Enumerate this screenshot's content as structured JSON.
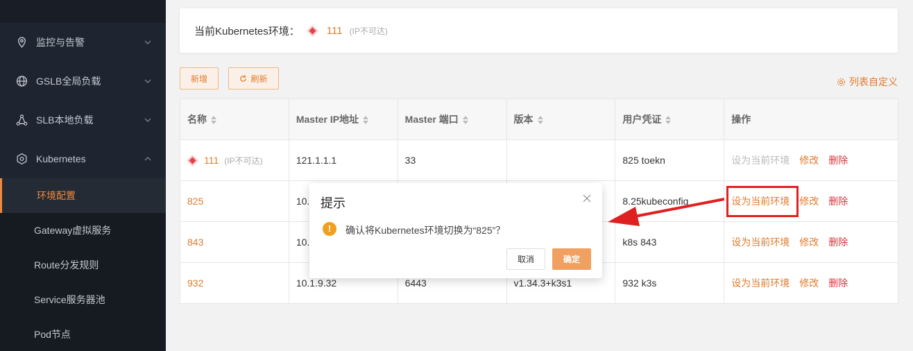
{
  "sidebar": {
    "groups": [
      {
        "label": "监控与告警",
        "icon": "location-pin-icon"
      },
      {
        "label": "GSLB全局负载",
        "icon": "globe-icon"
      },
      {
        "label": "SLB本地负载",
        "icon": "nodes-icon"
      },
      {
        "label": "Kubernetes",
        "icon": "kubernetes-icon"
      }
    ],
    "subitems": [
      {
        "label": "环境配置",
        "active": true
      },
      {
        "label": "Gateway虚拟服务"
      },
      {
        "label": "Route分发规则"
      },
      {
        "label": "Service服务器池"
      },
      {
        "label": "Pod节点"
      }
    ]
  },
  "env": {
    "label": "当前Kubernetes环境：",
    "name": "111",
    "note": "(IP不可达)"
  },
  "toolbar": {
    "add_label": "新增",
    "refresh_label": "刷新",
    "customize_label": "列表自定义"
  },
  "table": {
    "headers": [
      "名称",
      "Master IP地址",
      "Master 端口",
      "版本",
      "用户凭证",
      "操作"
    ],
    "rows": [
      {
        "name": "111",
        "note": "(IP不可达)",
        "ip": "121.1.1.1",
        "port": "33",
        "version": "",
        "credential": "825 toekn"
      },
      {
        "name": "825",
        "ip": "10.",
        "port": "",
        "version": "",
        "credential": "8.25kubeconfig"
      },
      {
        "name": "843",
        "ip": "10.",
        "port": "",
        "version": "",
        "credential": "k8s 843"
      },
      {
        "name": "932",
        "ip": "10.1.9.32",
        "port": "6443",
        "version": "v1.34.3+k3s1",
        "credential": "932 k3s"
      }
    ],
    "ops": {
      "set_current": "设为当前环境",
      "edit": "修改",
      "delete": "删除"
    }
  },
  "dialog": {
    "title": "提示",
    "message": "确认将Kubernetes环境切换为“825”？",
    "cancel": "取消",
    "ok": "确定"
  },
  "colors": {
    "accent": "#e07b2c",
    "danger": "#d9363e",
    "sidebar": "#1e2530"
  }
}
